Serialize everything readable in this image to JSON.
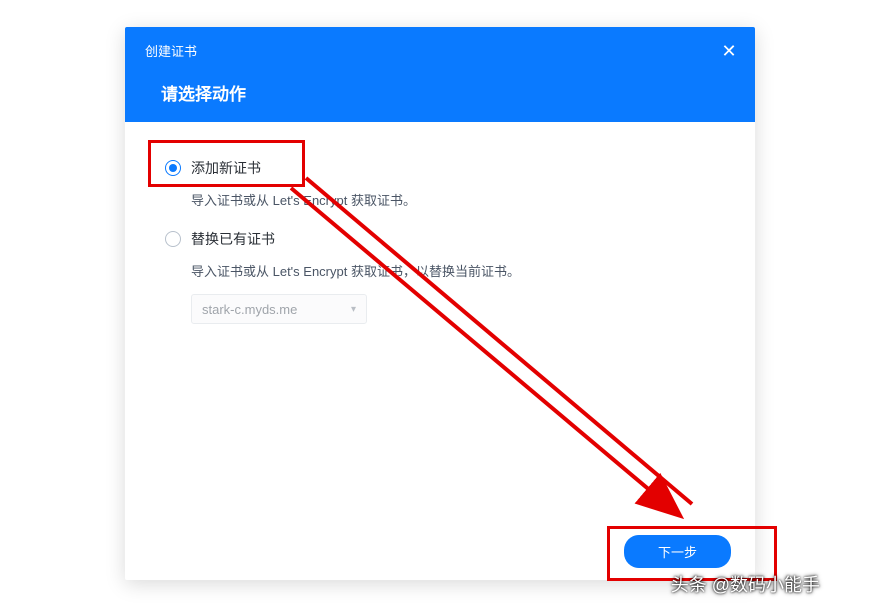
{
  "modal": {
    "title": "创建证书",
    "subtitle": "请选择动作",
    "close_label": "✕"
  },
  "options": {
    "add_new": {
      "label": "添加新证书",
      "desc": "导入证书或从 Let's Encrypt 获取证书。",
      "selected": true
    },
    "replace": {
      "label": "替换已有证书",
      "desc": "导入证书或从 Let's Encrypt 获取证书，以替换当前证书。",
      "selected": false
    }
  },
  "dropdown": {
    "value": "stark-c.myds.me",
    "caret": "▾"
  },
  "footer": {
    "next_label": "下一步"
  },
  "watermark": {
    "icon_text": "头条",
    "text": "头条 @数码小能手"
  }
}
